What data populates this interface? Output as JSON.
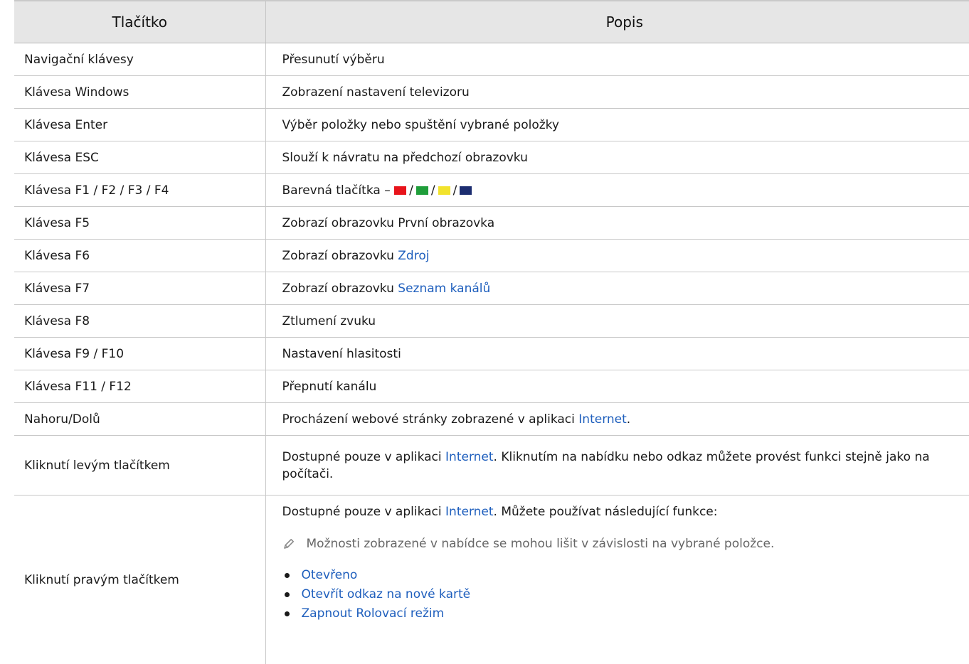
{
  "table": {
    "header": {
      "col1": "Tlačítko",
      "col2": "Popis"
    },
    "rows": [
      {
        "key": "Navigační klávesy",
        "desc": "Přesunutí výběru"
      },
      {
        "key": "Klávesa Windows",
        "desc": "Zobrazení nastavení televizoru"
      },
      {
        "key": "Klávesa Enter",
        "desc": "Výběr položky nebo spuštění vybrané položky"
      },
      {
        "key": "Klávesa ESC",
        "desc": "Slouží k návratu na předchozí obrazovku"
      },
      {
        "key": "Klávesa F1 / F2 / F3 / F4",
        "desc": "Barevná tlačítka –",
        "sep": "/"
      },
      {
        "key": "Klávesa F5",
        "desc": "Zobrazí obrazovku První obrazovka"
      },
      {
        "key": "Klávesa F6",
        "desc": "Zobrazí obrazovku",
        "link": "Zdroj"
      },
      {
        "key": "Klávesa F7",
        "desc": "Zobrazí obrazovku",
        "link": "Seznam kanálů"
      },
      {
        "key": "Klávesa F8",
        "desc": "Ztlumení zvuku"
      },
      {
        "key": "Klávesa F9 / F10",
        "desc": "Nastavení hlasitosti"
      },
      {
        "key": "Klávesa F11 / F12",
        "desc": "Přepnutí kanálu"
      },
      {
        "key": "Nahoru/Dolů",
        "desc": "Procházení webové stránky zobrazené v aplikaci",
        "link": "Internet",
        "after": "."
      },
      {
        "key": "Kliknutí levým tlačítkem",
        "desc": "Dostupné pouze v aplikaci",
        "link": "Internet",
        "after": ". Kliknutím na nabídku nebo odkaz můžete provést funkci stejně jako na počítači."
      },
      {
        "key": "Kliknutí pravým tlačítkem",
        "desc": "Dostupné pouze v aplikaci",
        "link": "Internet",
        "after": ". Můžete používat následující funkce:",
        "note": "Možnosti zobrazené v nabídce se mohou lišit v závislosti na vybrané položce.",
        "bullets": [
          "Otevřeno",
          "Otevřít odkaz na nové kartě",
          "Zapnout Rolovací režim"
        ]
      }
    ]
  },
  "colors": {
    "red": "#e8141b",
    "green": "#1f9e3a",
    "yellow": "#f2e32c",
    "blue": "#1c2d70",
    "link": "#1f5fbd",
    "header_bg": "#e6e6e6"
  },
  "icons": {
    "note": "pencil-note-icon",
    "bullet": "bullet-dot-icon"
  }
}
